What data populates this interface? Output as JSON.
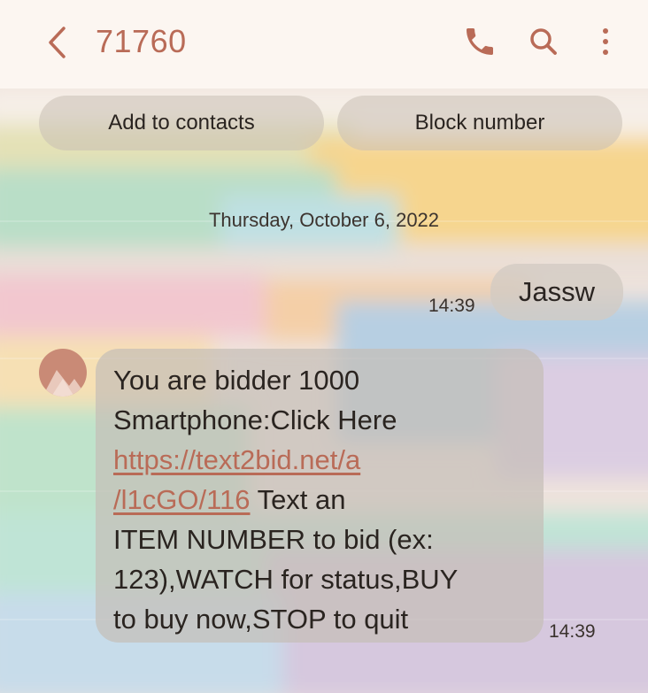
{
  "header": {
    "title": "71760",
    "icons": [
      "back-chevron-icon",
      "phone-icon",
      "search-icon",
      "more-vert-icon"
    ],
    "accent_color": "#b96b57"
  },
  "actions": {
    "add_to_contacts": "Add to contacts",
    "block_number": "Block number"
  },
  "date": "Thursday, October 6, 2022",
  "messages": [
    {
      "direction": "outgoing",
      "text": "Jassw",
      "time": "14:39"
    },
    {
      "direction": "incoming",
      "lines": [
        "You are bidder 1000",
        "Smartphone:Click Here",
        "https://text2bid.net/a",
        "/l1cGO/116",
        " Text an",
        "ITEM NUMBER to bid (ex:",
        "123),WATCH for status,BUY",
        "to buy now,STOP to quit"
      ],
      "time": "14:39"
    }
  ]
}
